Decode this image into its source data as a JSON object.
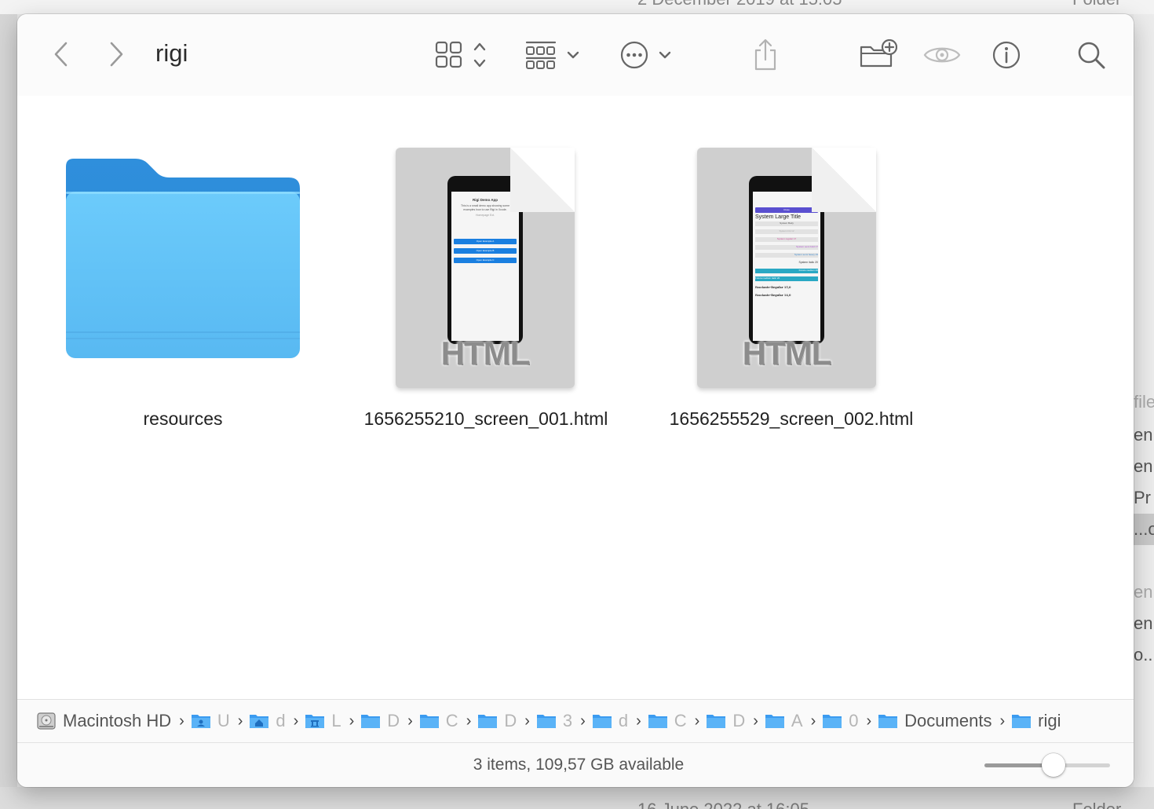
{
  "background": {
    "top_left_text": "2 December 2019 at 15:05",
    "top_right_text": "Folder",
    "bottom_left_text": "16 June 2022 at 16:05",
    "bottom_right_text": "Folder",
    "right_rows": [
      "file",
      "en",
      "en",
      "Pr",
      "...o",
      "",
      "en",
      "en",
      "o..."
    ]
  },
  "window": {
    "title": "rigi",
    "accent_color": "#3b9bf0"
  },
  "toolbar": {
    "back_icon": "chevron-left-icon",
    "forward_icon": "chevron-right-icon",
    "view_icon": "grid-view-icon",
    "group_icon": "group-icon",
    "action_icon": "ellipsis-circle-icon",
    "share_icon": "share-icon",
    "new_folder_icon": "new-folder-icon",
    "quicklook_icon": "eye-icon",
    "info_icon": "info-icon",
    "search_icon": "search-icon"
  },
  "files": [
    {
      "name": "resources",
      "kind": "folder"
    },
    {
      "name": "1656255210_screen_001.html",
      "kind": "html",
      "badge": "HTML",
      "preview": {
        "title": "Rigi Demo App",
        "body": "This is a small demo app showing some examples how to use Rigi in Xcode.",
        "link": "Homepage Ext.",
        "buttons": [
          "Open Example A",
          "Open Example B",
          "Open Example C"
        ]
      }
    },
    {
      "name": "1656255529_screen_002.html",
      "kind": "html",
      "badge": "HTML",
      "preview": {
        "header": "Close",
        "title": "System Large Title",
        "rows": [
          "System Body",
          "System tint 12",
          "System regular 17",
          "System semi bold 17",
          "System semi heavy 19",
          "System italic 20",
          "Futura medium 20",
          "Futura medium italic 20",
          "Fasciante-Regular 15,0",
          "Fasciante-Regular 14,0"
        ]
      }
    }
  ],
  "pathbar": {
    "items": [
      {
        "label": "Macintosh HD",
        "icon": "hard-drive-icon",
        "faint": false
      },
      {
        "label": "U",
        "icon": "user-folder-icon",
        "faint": true
      },
      {
        "label": "d",
        "icon": "home-folder-icon",
        "faint": true
      },
      {
        "label": "L",
        "icon": "library-folder-icon",
        "faint": true
      },
      {
        "label": "D",
        "icon": "folder-icon",
        "faint": true
      },
      {
        "label": "C",
        "icon": "folder-icon",
        "faint": true
      },
      {
        "label": "D",
        "icon": "folder-icon",
        "faint": true
      },
      {
        "label": "3",
        "icon": "folder-icon",
        "faint": true
      },
      {
        "label": "d",
        "icon": "folder-icon",
        "faint": true
      },
      {
        "label": "C",
        "icon": "folder-icon",
        "faint": true
      },
      {
        "label": "D",
        "icon": "folder-icon",
        "faint": true
      },
      {
        "label": "A",
        "icon": "folder-icon",
        "faint": true
      },
      {
        "label": "0",
        "icon": "folder-icon",
        "faint": true
      },
      {
        "label": "Documents",
        "icon": "folder-icon",
        "faint": false
      },
      {
        "label": "rigi",
        "icon": "folder-icon",
        "faint": false
      }
    ]
  },
  "status": {
    "text": "3 items, 109,57 GB available",
    "icon_size_fraction": 0.55
  }
}
